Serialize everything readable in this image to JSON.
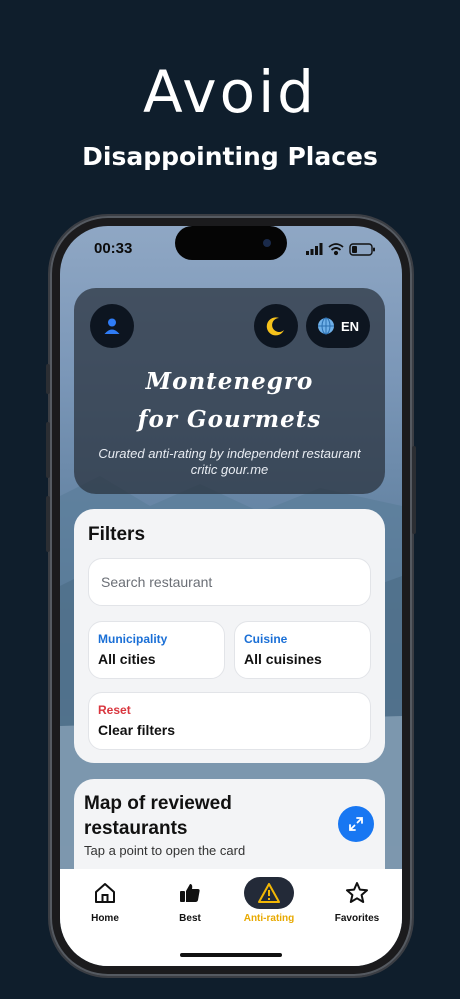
{
  "promo": {
    "headline": "Avoid",
    "subline": "Disappointing Places"
  },
  "status_bar": {
    "time": "00:33"
  },
  "header": {
    "title_line1": "Montenegro",
    "title_line2": "for Gourmets",
    "tagline": "Curated anti-rating by independent restaurant critic gour.me",
    "language_label": "EN"
  },
  "filters": {
    "title": "Filters",
    "search_placeholder": "Search restaurant",
    "municipality_label": "Municipality",
    "municipality_value": "All cities",
    "cuisine_label": "Cuisine",
    "cuisine_value": "All cuisines",
    "reset_label": "Reset",
    "reset_value": "Clear filters"
  },
  "map": {
    "title": "Map of reviewed restaurants",
    "subtitle": "Tap a point to open the card"
  },
  "tabs": [
    {
      "label": "Home",
      "icon": "home-icon"
    },
    {
      "label": "Best",
      "icon": "thumbs-up-icon"
    },
    {
      "label": "Anti-rating",
      "icon": "warning-icon"
    },
    {
      "label": "Favorites",
      "icon": "star-icon"
    }
  ],
  "colors": {
    "background": "#0f1e2c",
    "accent_blue": "#1877f2",
    "reset_red": "#d9363e",
    "active_tab_yellow": "#f2b705",
    "label_blue": "#1a6fd6"
  }
}
